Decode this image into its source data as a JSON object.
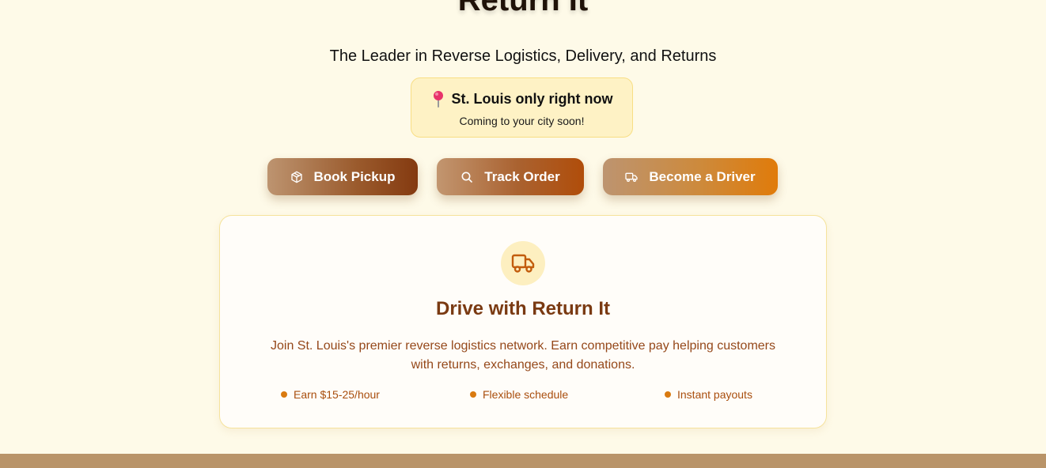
{
  "hero": {
    "title": "Return It",
    "tagline": "The Leader in Reverse Logistics, Delivery, and Returns"
  },
  "location": {
    "icon": "map-pin-icon",
    "title": "St. Louis only right now",
    "subtitle": "Coming to your city soon!"
  },
  "actions": {
    "book_pickup": "Book Pickup",
    "track_order": "Track Order",
    "become_driver": "Become a Driver"
  },
  "driver_card": {
    "icon": "truck-icon",
    "title": "Drive with Return It",
    "description": "Join St. Louis's premier reverse logistics network. Earn competitive pay helping customers with returns, exchanges, and donations.",
    "perks": [
      "Earn $15-25/hour",
      "Flexible schedule",
      "Instant payouts"
    ]
  },
  "colors": {
    "background": "#fefae8",
    "accent": "#d97a10",
    "brand_brown": "#7a3a12",
    "footer": "#b99469"
  }
}
